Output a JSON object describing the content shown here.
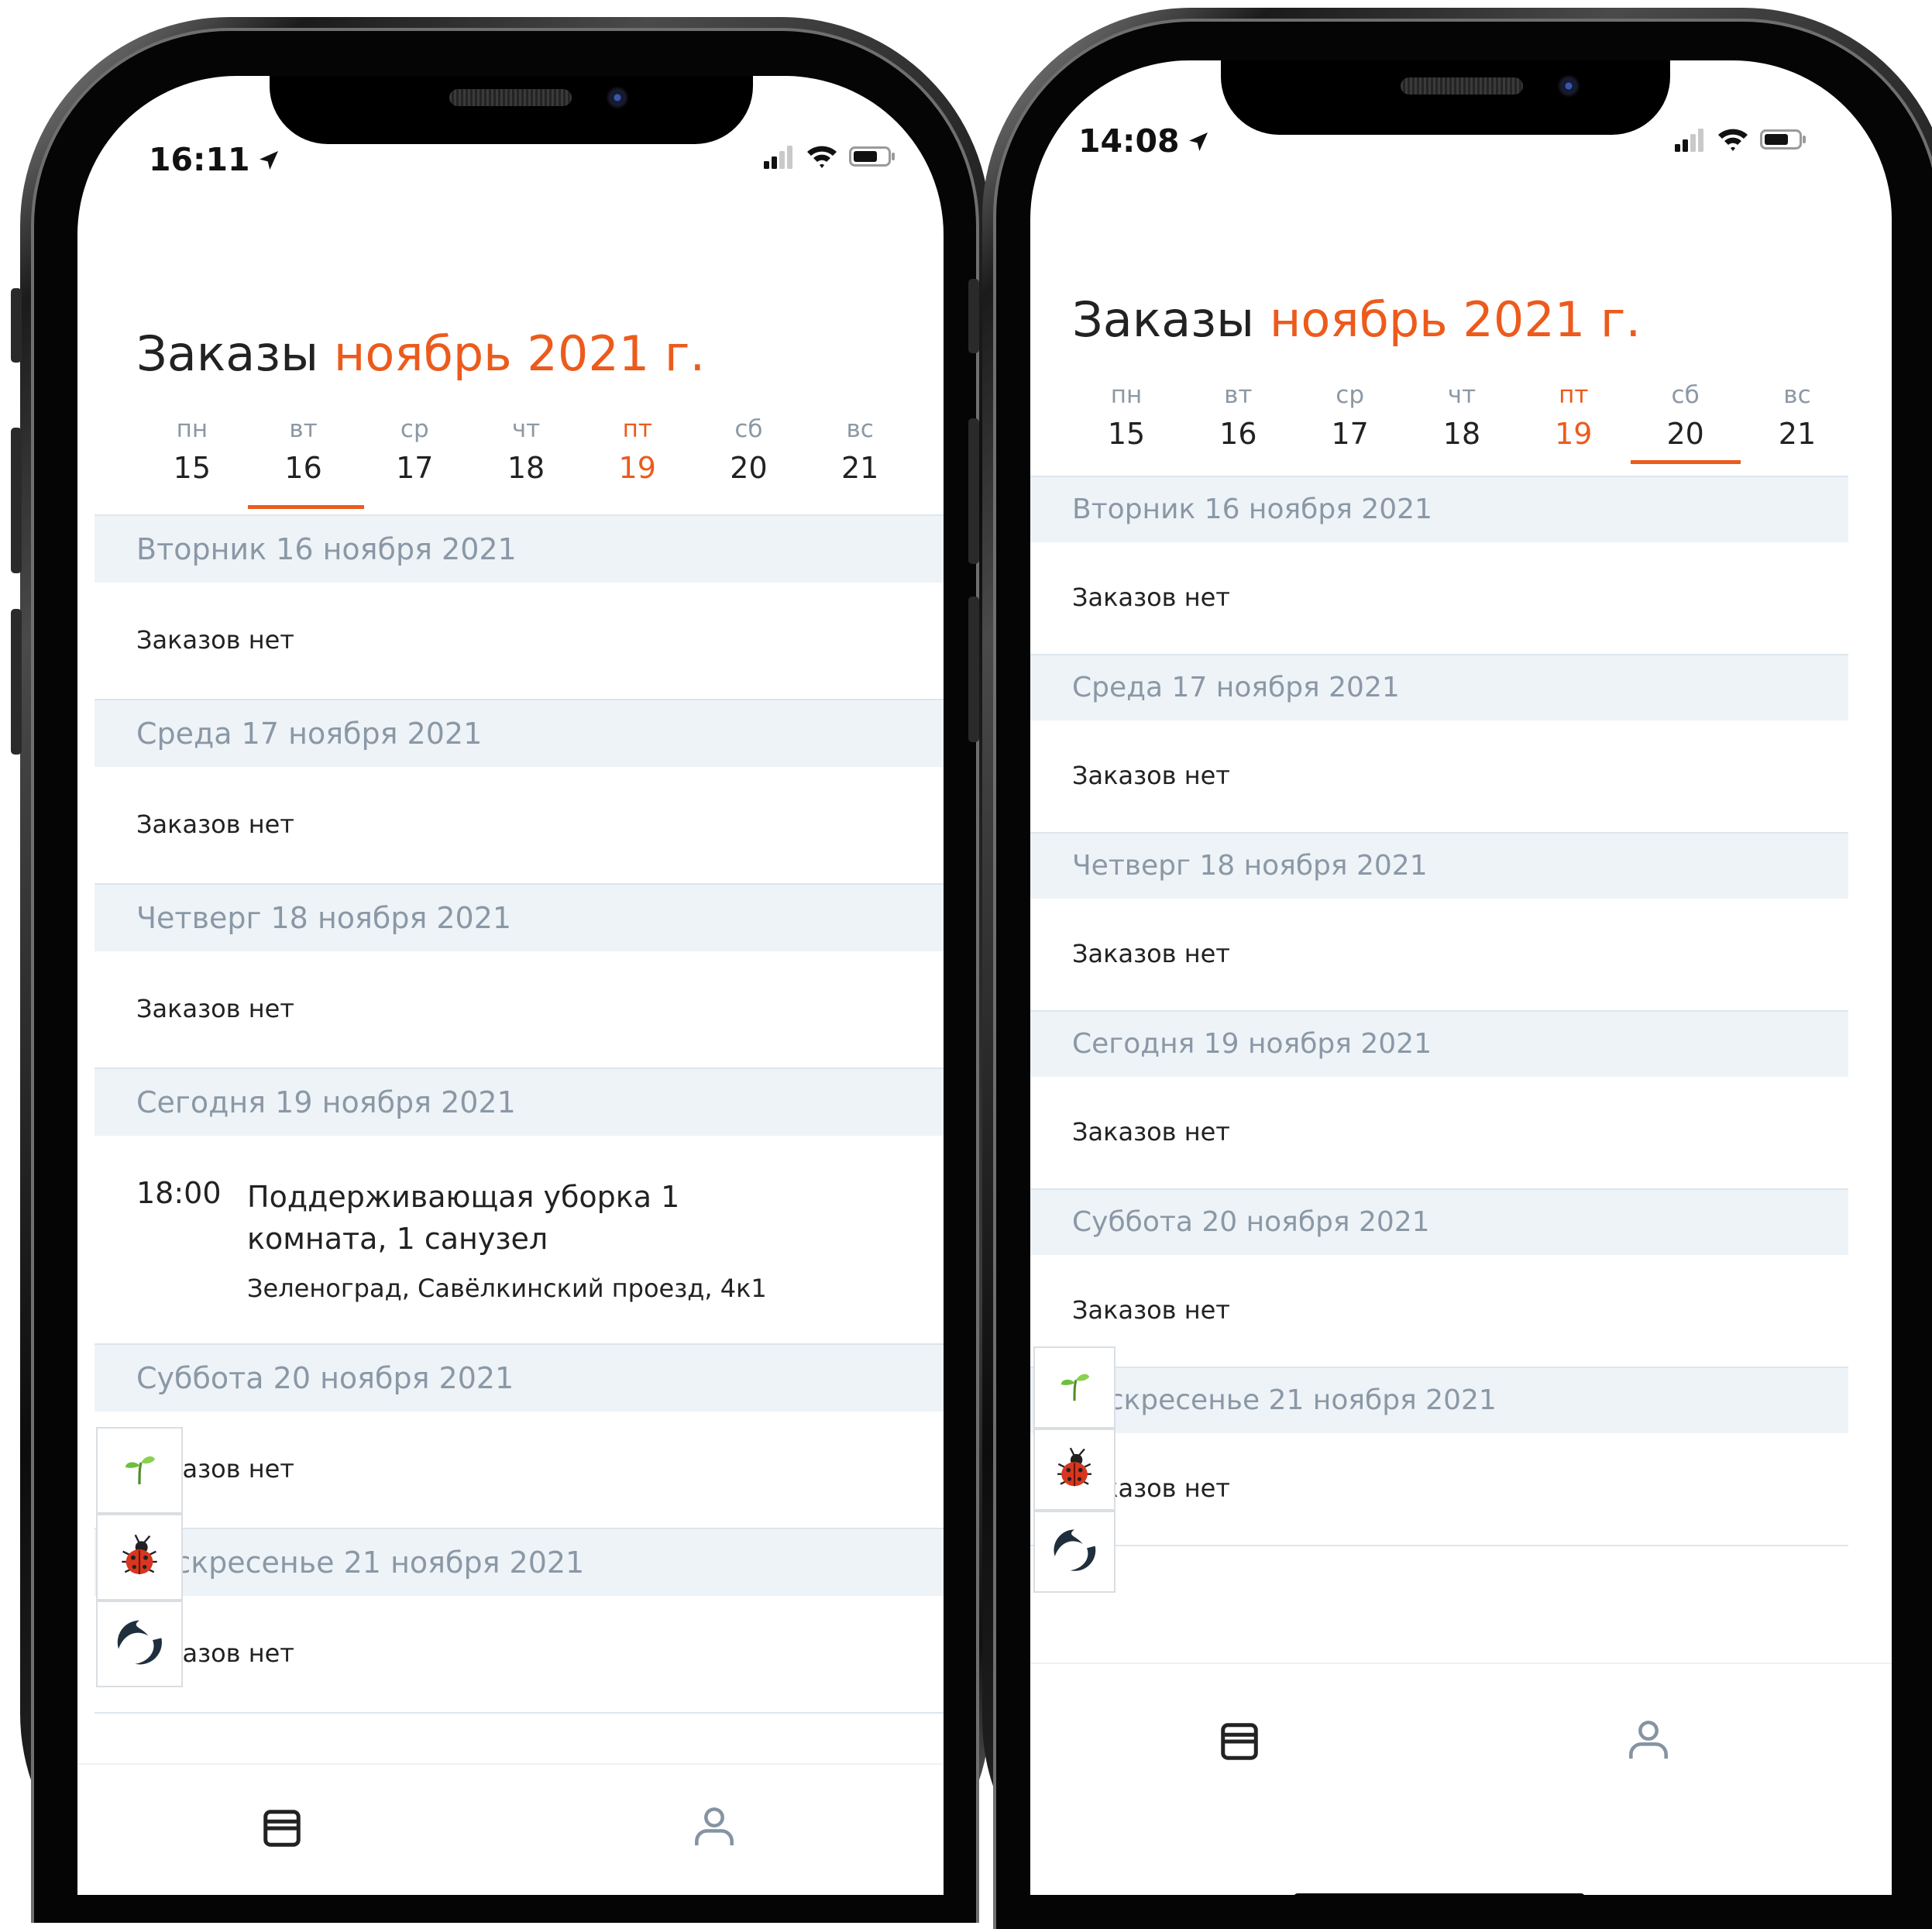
{
  "phones": [
    {
      "status": {
        "time": "16:11"
      },
      "header": {
        "title_prefix": "Заказы",
        "title_month": "ноябрь 2021 г."
      },
      "week": [
        {
          "dn": "пн",
          "dd": "15"
        },
        {
          "dn": "вт",
          "dd": "16"
        },
        {
          "dn": "ср",
          "dd": "17"
        },
        {
          "dn": "чт",
          "dd": "18"
        },
        {
          "dn": "пт",
          "dd": "19"
        },
        {
          "dn": "сб",
          "dd": "20"
        },
        {
          "dn": "вс",
          "dd": "21"
        }
      ],
      "selected_day": "16",
      "today_day": "19",
      "sections": [
        {
          "title": "Вторник 16 ноября 2021",
          "empty": "Заказов нет"
        },
        {
          "title": "Среда 17 ноября 2021",
          "empty": "Заказов нет"
        },
        {
          "title": "Четверг 18 ноября 2021",
          "empty": "Заказов нет"
        },
        {
          "title": "Сегодня 19 ноября 2021",
          "order": {
            "time": "18:00",
            "title": "Поддерживающая уборка 1 комната, 1 санузел",
            "address": "Зеленоград, Савёлкинский проезд, 4к1"
          }
        },
        {
          "title": "Суббота 20 ноября 2021",
          "empty": "Заказов нет"
        },
        {
          "title": "Воскресенье 21 ноября 2021",
          "empty": "Заказов нет"
        }
      ]
    },
    {
      "status": {
        "time": "14:08"
      },
      "header": {
        "title_prefix": "Заказы",
        "title_month": "ноябрь 2021 г."
      },
      "week": [
        {
          "dn": "пн",
          "dd": "15"
        },
        {
          "dn": "вт",
          "dd": "16"
        },
        {
          "dn": "ср",
          "dd": "17"
        },
        {
          "dn": "чт",
          "dd": "18"
        },
        {
          "dn": "пт",
          "dd": "19"
        },
        {
          "dn": "сб",
          "dd": "20"
        },
        {
          "dn": "вс",
          "dd": "21"
        }
      ],
      "selected_day": "20",
      "today_day": "19",
      "sections": [
        {
          "title": "Вторник 16 ноября 2021",
          "empty": "Заказов нет"
        },
        {
          "title": "Среда 17 ноября 2021",
          "empty": "Заказов нет"
        },
        {
          "title": "Четверг 18 ноября 2021",
          "empty": "Заказов нет"
        },
        {
          "title": "Сегодня 19 ноября 2021",
          "empty": "Заказов нет"
        },
        {
          "title": "Суббота 20 ноября 2021",
          "empty": "Заказов нет"
        },
        {
          "title": "Воскресенье 21 ноября 2021",
          "empty": "Заказов нет"
        }
      ]
    }
  ],
  "tabbar": {
    "tabs": [
      {
        "icon": "orders-icon"
      },
      {
        "icon": "profile-icon"
      }
    ]
  },
  "overlay_tools": [
    {
      "icon": "sprout-icon"
    },
    {
      "icon": "ladybug-icon"
    },
    {
      "icon": "swirl-logo-icon"
    }
  ],
  "colors": {
    "accent": "#ec5b1c",
    "section_bg": "#eef3f7",
    "muted_text": "#8a98a6",
    "text": "#222222"
  }
}
